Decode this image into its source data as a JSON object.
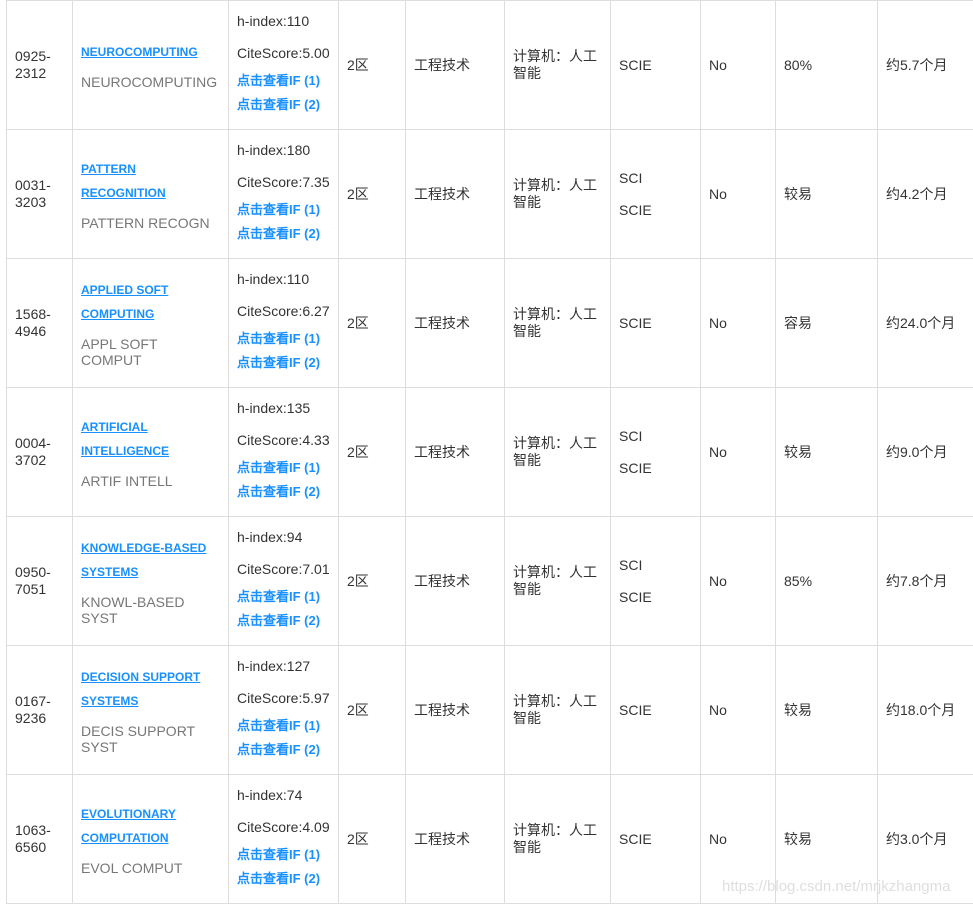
{
  "rows": [
    {
      "issn": [
        "0925-",
        "2312"
      ],
      "title": [
        "NEUROCOMPUTING"
      ],
      "abbr": "NEUROCOMPUTING",
      "h_index": "h-index:110",
      "citescore": "CiteScore:5.00",
      "if1": "点击查看IF (1)",
      "if2": "点击查看IF (2)",
      "zone": "2区",
      "category": "工程技术",
      "subcategory": "计算机：人工智能",
      "index": [
        "SCIE"
      ],
      "oa": "No",
      "acceptance": "80%",
      "review": "约5.7个月"
    },
    {
      "issn": [
        "0031-",
        "3203"
      ],
      "title": [
        "PATTERN",
        "RECOGNITION"
      ],
      "abbr": "PATTERN RECOGN",
      "h_index": "h-index:180",
      "citescore": "CiteScore:7.35",
      "if1": "点击查看IF (1)",
      "if2": "点击查看IF (2)",
      "zone": "2区",
      "category": "工程技术",
      "subcategory": "计算机：人工智能",
      "index": [
        "SCI",
        "SCIE"
      ],
      "oa": "No",
      "acceptance": "较易",
      "review": "约4.2个月"
    },
    {
      "issn": [
        "1568-",
        "4946"
      ],
      "title": [
        "APPLIED SOFT",
        "COMPUTING"
      ],
      "abbr": "APPL SOFT COMPUT",
      "h_index": "h-index:110",
      "citescore": "CiteScore:6.27",
      "if1": "点击查看IF (1)",
      "if2": "点击查看IF (2)",
      "zone": "2区",
      "category": "工程技术",
      "subcategory": "计算机：人工智能",
      "index": [
        "SCIE"
      ],
      "oa": "No",
      "acceptance": "容易",
      "review": "约24.0个月"
    },
    {
      "issn": [
        "0004-",
        "3702"
      ],
      "title": [
        "ARTIFICIAL",
        "INTELLIGENCE"
      ],
      "abbr": "ARTIF INTELL",
      "h_index": "h-index:135",
      "citescore": "CiteScore:4.33",
      "if1": "点击查看IF (1)",
      "if2": "点击查看IF (2)",
      "zone": "2区",
      "category": "工程技术",
      "subcategory": "计算机：人工智能",
      "index": [
        "SCI",
        "SCIE"
      ],
      "oa": "No",
      "acceptance": "较易",
      "review": "约9.0个月"
    },
    {
      "issn": [
        "0950-",
        "7051"
      ],
      "title": [
        "KNOWLEDGE-BASED",
        "SYSTEMS"
      ],
      "abbr": "KNOWL-BASED SYST",
      "h_index": "h-index:94",
      "citescore": "CiteScore:7.01",
      "if1": "点击查看IF (1)",
      "if2": "点击查看IF (2)",
      "zone": "2区",
      "category": "工程技术",
      "subcategory": "计算机：人工智能",
      "index": [
        "SCI",
        "SCIE"
      ],
      "oa": "No",
      "acceptance": "85%",
      "review": "约7.8个月"
    },
    {
      "issn": [
        "0167-",
        "9236"
      ],
      "title": [
        "DECISION SUPPORT",
        "SYSTEMS"
      ],
      "abbr": "DECIS SUPPORT SYST",
      "h_index": "h-index:127",
      "citescore": "CiteScore:5.97",
      "if1": "点击查看IF (1)",
      "if2": "点击查看IF (2)",
      "zone": "2区",
      "category": "工程技术",
      "subcategory": "计算机：人工智能",
      "index": [
        "SCIE"
      ],
      "oa": "No",
      "acceptance": "较易",
      "review": "约18.0个月"
    },
    {
      "issn": [
        "1063-",
        "6560"
      ],
      "title": [
        "EVOLUTIONARY",
        "COMPUTATION"
      ],
      "abbr": "EVOL COMPUT",
      "h_index": "h-index:74",
      "citescore": "CiteScore:4.09",
      "if1": "点击查看IF (1)",
      "if2": "点击查看IF (2)",
      "zone": "2区",
      "category": "工程技术",
      "subcategory": "计算机：人工智能",
      "index": [
        "SCIE"
      ],
      "oa": "No",
      "acceptance": "较易",
      "review": "约3.0个月"
    }
  ],
  "watermark": "https://blog.csdn.net/mrjkzhangma"
}
